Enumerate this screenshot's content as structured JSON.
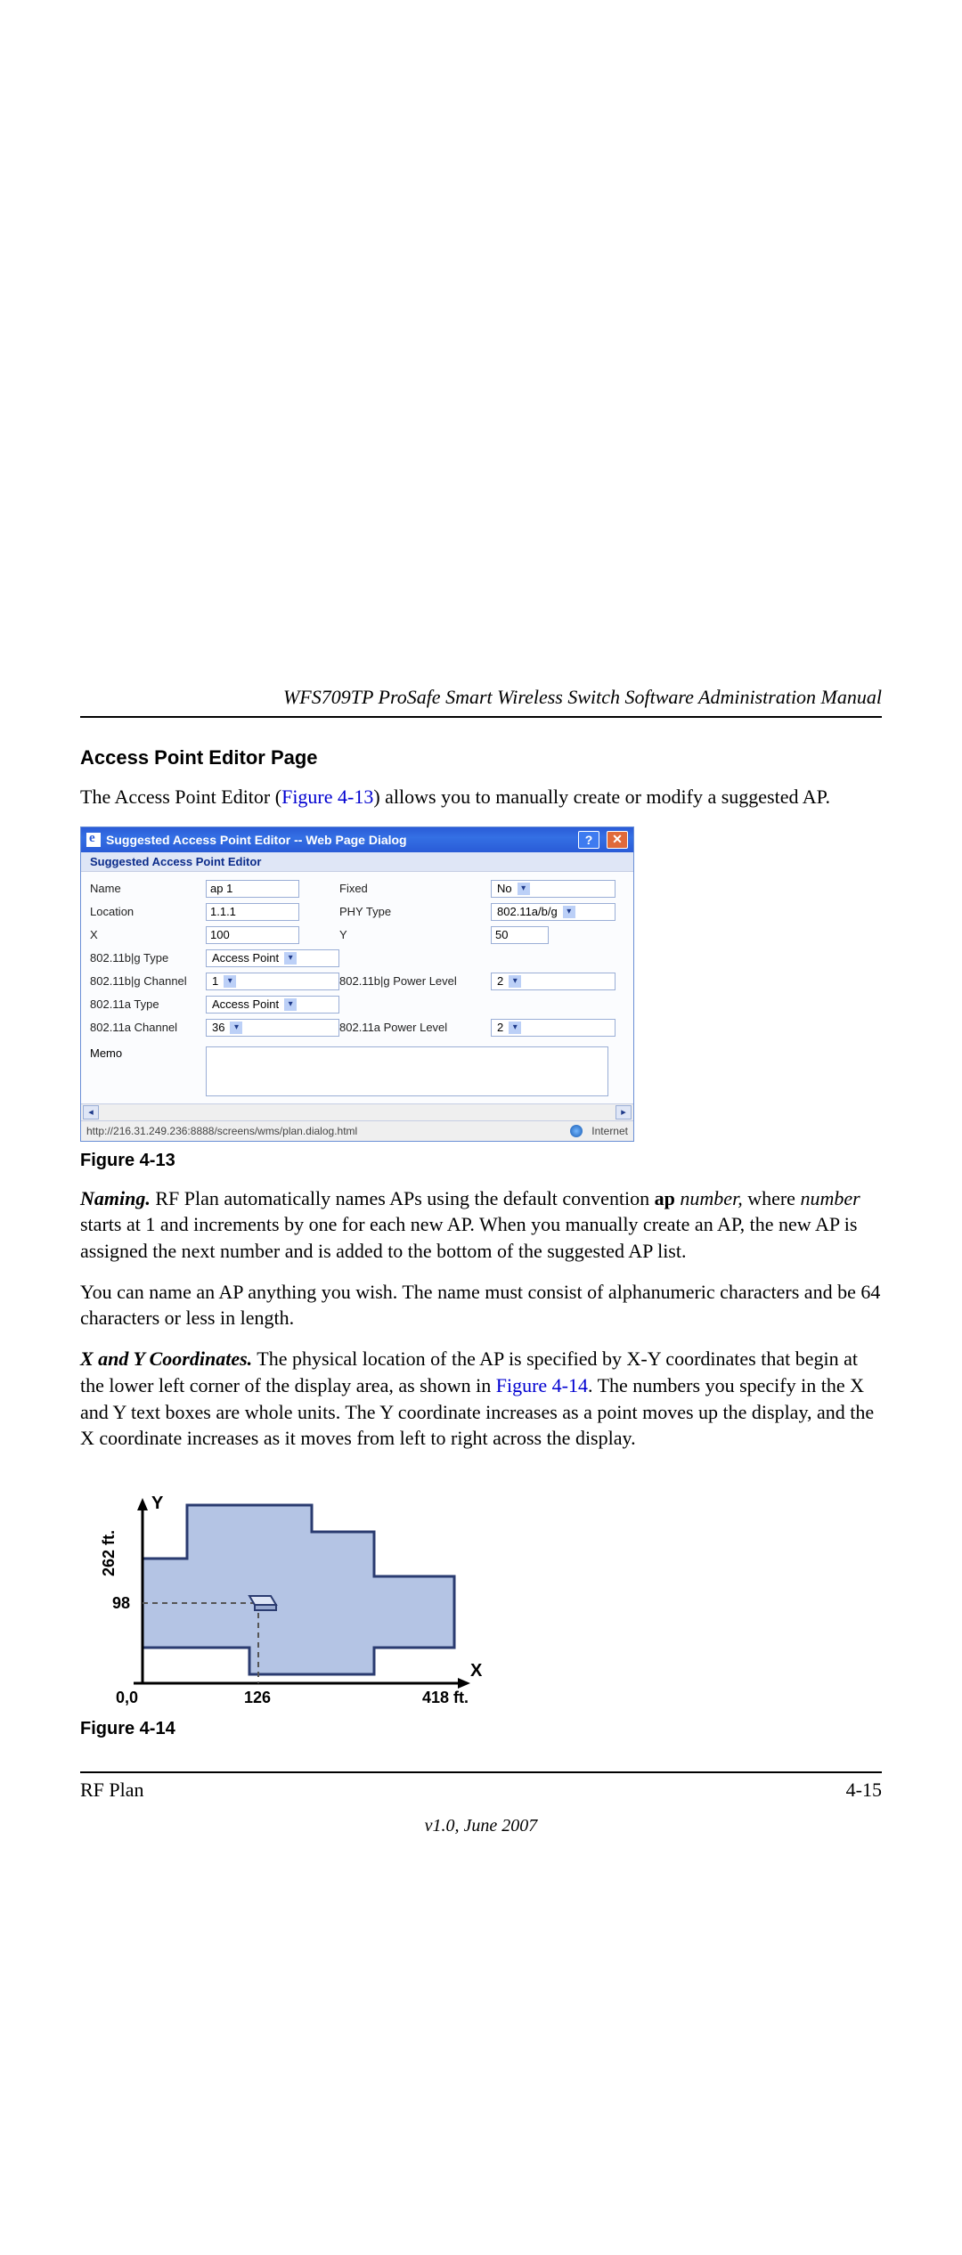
{
  "header": {
    "doc_title": "WFS709TP ProSafe Smart Wireless Switch Software Administration Manual"
  },
  "section": {
    "heading": "Access Point Editor Page",
    "intro_pre": "The Access Point Editor (",
    "intro_link": "Figure 4-13",
    "intro_post": ") allows you to manually create or modify a suggested AP."
  },
  "dialog": {
    "title": "Suggested Access Point Editor -- Web Page Dialog",
    "subheading": "Suggested Access Point Editor",
    "fields": {
      "name_lbl": "Name",
      "name_val": "ap 1",
      "fixed_lbl": "Fixed",
      "fixed_val": "No",
      "location_lbl": "Location",
      "location_val": "1.1.1",
      "phy_lbl": "PHY Type",
      "phy_val": "802.11a/b/g",
      "x_lbl": "X",
      "x_val": "100",
      "y_lbl": "Y",
      "y_val": "50",
      "bg_type_lbl": "802.11b|g Type",
      "bg_type_val": "Access Point",
      "bg_ch_lbl": "802.11b|g Channel",
      "bg_ch_val": "1",
      "bg_pw_lbl": "802.11b|g Power Level",
      "bg_pw_val": "2",
      "a_type_lbl": "802.11a Type",
      "a_type_val": "Access Point",
      "a_ch_lbl": "802.11a Channel",
      "a_ch_val": "36",
      "a_pw_lbl": "802.11a Power Level",
      "a_pw_val": "2",
      "memo_lbl": "Memo"
    },
    "status_url": "http://216.31.249.236:8888/screens/wms/plan.dialog.html",
    "status_zone": "Internet"
  },
  "fig13_label": "Figure 4-13",
  "naming": {
    "lead": "Naming.",
    "t1a": " RF Plan automatically names APs using the default convention ",
    "ap": "ap",
    "space": " ",
    "number": "number,",
    "t1b": " where ",
    "number2": "number",
    "t1c": " starts at 1 and increments by one for each new AP. When you manually create an AP, the new AP is assigned the next number and is added to the bottom of the suggested AP list.",
    "t2": "You can name an AP anything you wish. The name must consist of alphanumeric characters and be 64 characters or less in length."
  },
  "xy": {
    "lead": "X and Y Coordinates.",
    "t1a": " The physical location of the AP is specified by X-Y coordinates that begin at the lower left corner of the display area, as shown in ",
    "link": "Figure 4-14",
    "t1b": ". The numbers you specify in the X and Y text boxes are whole units. The Y coordinate increases as a point moves up the display, and the X coordinate increases as it moves from left to right across the display."
  },
  "coord_fig": {
    "y_label": "262 ft.",
    "y_axis": "Y",
    "y_tick": "98",
    "origin": "0,0",
    "x_tick": "126",
    "x_max": "418 ft.",
    "x_axis": "X"
  },
  "fig14_label": "Figure 4-14",
  "footer": {
    "left": "RF Plan",
    "right": "4-15",
    "version": "v1.0, June 2007"
  }
}
